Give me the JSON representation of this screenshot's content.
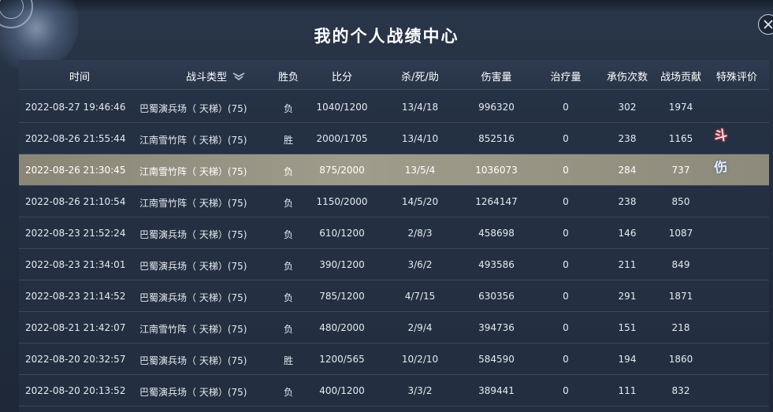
{
  "window": {
    "title": "我的个人战绩中心"
  },
  "columns": {
    "time": "时间",
    "type": "战斗类型",
    "result": "胜负",
    "score": "比分",
    "kda": "杀/死/助",
    "damage": "伤害量",
    "heal": "治疗量",
    "taken": "承伤次数",
    "contrib": "战场贡献",
    "special": "特殊评价"
  },
  "rows": [
    {
      "time": "2022-08-27 19:46:46",
      "type": "巴蜀演兵场（ 天梯）(75)",
      "result": "负",
      "score": "1040/1200",
      "kda": "13/4/18",
      "damage": "996320",
      "heal": "0",
      "taken": "302",
      "contrib": "1974"
    },
    {
      "time": "2022-08-26 21:55:44",
      "type": "江南雪竹阵（ 天梯）(75)",
      "result": "胜",
      "score": "2000/1705",
      "kda": "13/4/10",
      "damage": "852516",
      "heal": "0",
      "taken": "238",
      "contrib": "1165"
    },
    {
      "time": "2022-08-26 21:30:45",
      "type": "江南雪竹阵（ 天梯）(75)",
      "result": "负",
      "score": "875/2000",
      "kda": "13/5/4",
      "damage": "1036073",
      "heal": "0",
      "taken": "284",
      "contrib": "737"
    },
    {
      "time": "2022-08-26 21:10:54",
      "type": "江南雪竹阵（ 天梯）(75)",
      "result": "负",
      "score": "1150/2000",
      "kda": "14/5/20",
      "damage": "1264147",
      "heal": "0",
      "taken": "238",
      "contrib": "850"
    },
    {
      "time": "2022-08-23 21:52:24",
      "type": "巴蜀演兵场（ 天梯）(75)",
      "result": "负",
      "score": "610/1200",
      "kda": "2/8/3",
      "damage": "458698",
      "heal": "0",
      "taken": "146",
      "contrib": "1087"
    },
    {
      "time": "2022-08-23 21:34:01",
      "type": "巴蜀演兵场（ 天梯）(75)",
      "result": "负",
      "score": "390/1200",
      "kda": "3/6/2",
      "damage": "493586",
      "heal": "0",
      "taken": "211",
      "contrib": "849"
    },
    {
      "time": "2022-08-23 21:14:52",
      "type": "巴蜀演兵场（ 天梯）(75)",
      "result": "负",
      "score": "785/1200",
      "kda": "4/7/15",
      "damage": "630356",
      "heal": "0",
      "taken": "291",
      "contrib": "1871"
    },
    {
      "time": "2022-08-21 21:42:07",
      "type": "江南雪竹阵（ 天梯）(75)",
      "result": "负",
      "score": "480/2000",
      "kda": "2/9/4",
      "damage": "394736",
      "heal": "0",
      "taken": "151",
      "contrib": "218"
    },
    {
      "time": "2022-08-20 20:32:57",
      "type": "巴蜀演兵场（ 天梯）(75)",
      "result": "胜",
      "score": "1200/565",
      "kda": "10/2/10",
      "damage": "584590",
      "heal": "0",
      "taken": "194",
      "contrib": "1860"
    },
    {
      "time": "2022-08-20 20:13:52",
      "type": "巴蜀演兵场（ 天梯）(75)",
      "result": "负",
      "score": "400/1200",
      "kda": "3/3/2",
      "damage": "389441",
      "heal": "0",
      "taken": "111",
      "contrib": "832"
    }
  ],
  "special_marks": {
    "mark1": "斗",
    "mark2": "伤"
  },
  "icons": {
    "close": "close-icon",
    "filter": "chevron-double-down-icon",
    "emblem": "compass-emblem-icon"
  },
  "colors": {
    "selected_row": "#9a9686",
    "background": "#222d3f",
    "mark_glow": "#c0304a"
  }
}
